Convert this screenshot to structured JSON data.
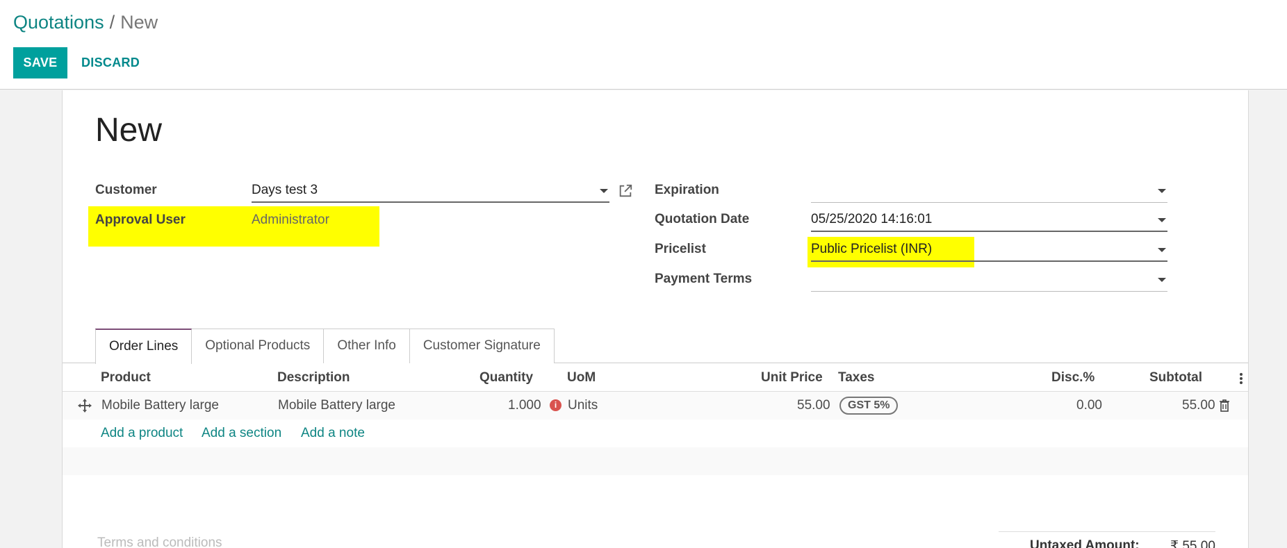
{
  "breadcrumb": {
    "parent": "Quotations",
    "separator": "/",
    "current": "New"
  },
  "toolbar": {
    "save_label": "SAVE",
    "discard_label": "DISCARD"
  },
  "record": {
    "title": "New"
  },
  "fields": {
    "customer_label": "Customer",
    "customer_value": "Days test 3",
    "approval_user_label": "Approval User",
    "approval_user_value": "Administrator",
    "expiration_label": "Expiration",
    "expiration_value": "",
    "quotation_date_label": "Quotation Date",
    "quotation_date_value": "05/25/2020 14:16:01",
    "pricelist_label": "Pricelist",
    "pricelist_value": "Public Pricelist (INR)",
    "payment_terms_label": "Payment Terms",
    "payment_terms_value": ""
  },
  "tabs": [
    {
      "label": "Order Lines"
    },
    {
      "label": "Optional Products"
    },
    {
      "label": "Other Info"
    },
    {
      "label": "Customer Signature"
    }
  ],
  "order_lines": {
    "columns": [
      "Product",
      "Description",
      "Quantity",
      "UoM",
      "Unit Price",
      "Taxes",
      "Disc.%",
      "Subtotal"
    ],
    "rows": [
      {
        "product": "Mobile Battery large",
        "description": "Mobile Battery large",
        "quantity": "1.000",
        "uom": "Units",
        "unit_price": "55.00",
        "taxes": "GST 5%",
        "discount": "0.00",
        "subtotal": "55.00"
      }
    ],
    "add_product": "Add a product",
    "add_section": "Add a section",
    "add_note": "Add a note"
  },
  "footer": {
    "terms_placeholder": "Terms and conditions",
    "untaxed_label": "Untaxed Amount:",
    "untaxed_value": "₹ 55.00"
  },
  "colors": {
    "accent": "#00a09d",
    "link": "#0e8583",
    "highlight": "#ffff00",
    "tab_active": "#7c4d77"
  }
}
